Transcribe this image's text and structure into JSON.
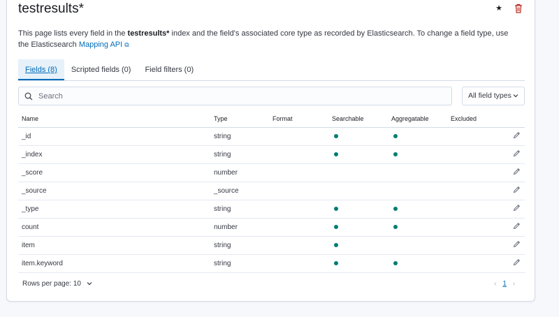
{
  "header": {
    "title": "testresults*",
    "description_before": "This page lists every field in the ",
    "description_index": "testresults*",
    "description_after": " index and the field's associated core type as recorded by Elasticsearch. To change a field type, use the Elasticsearch ",
    "description_link": "Mapping API",
    "external_link_glyph": "⧉"
  },
  "tabs": [
    {
      "label": "Fields (8)",
      "active": true
    },
    {
      "label": "Scripted fields (0)",
      "active": false
    },
    {
      "label": "Field filters (0)",
      "active": false
    }
  ],
  "search": {
    "placeholder": "Search",
    "value": ""
  },
  "filter": {
    "label": "All field types"
  },
  "table": {
    "columns": [
      "Name",
      "Type",
      "Format",
      "Searchable",
      "Aggregatable",
      "Excluded"
    ],
    "rows": [
      {
        "name": "_id",
        "type": "string",
        "format": "",
        "searchable": true,
        "aggregatable": true,
        "excluded": false
      },
      {
        "name": "_index",
        "type": "string",
        "format": "",
        "searchable": true,
        "aggregatable": true,
        "excluded": false
      },
      {
        "name": "_score",
        "type": "number",
        "format": "",
        "searchable": false,
        "aggregatable": false,
        "excluded": false
      },
      {
        "name": "_source",
        "type": "_source",
        "format": "",
        "searchable": false,
        "aggregatable": false,
        "excluded": false
      },
      {
        "name": "_type",
        "type": "string",
        "format": "",
        "searchable": true,
        "aggregatable": true,
        "excluded": false
      },
      {
        "name": "count",
        "type": "number",
        "format": "",
        "searchable": true,
        "aggregatable": true,
        "excluded": false
      },
      {
        "name": "item",
        "type": "string",
        "format": "",
        "searchable": true,
        "aggregatable": false,
        "excluded": false
      },
      {
        "name": "item.keyword",
        "type": "string",
        "format": "",
        "searchable": true,
        "aggregatable": true,
        "excluded": false
      }
    ]
  },
  "pagination": {
    "rows_per_page_label": "Rows per page: 10",
    "current_page": "1",
    "prev_glyph": "‹",
    "next_glyph": "›"
  },
  "icons": {
    "star": "star-icon",
    "trash": "trash-icon",
    "search": "search-icon",
    "edit": "pencil-icon",
    "chevron": "chevron-down-icon"
  },
  "colors": {
    "accent": "#006bb8",
    "dot": "#017d73",
    "delete": "#bd271e"
  }
}
